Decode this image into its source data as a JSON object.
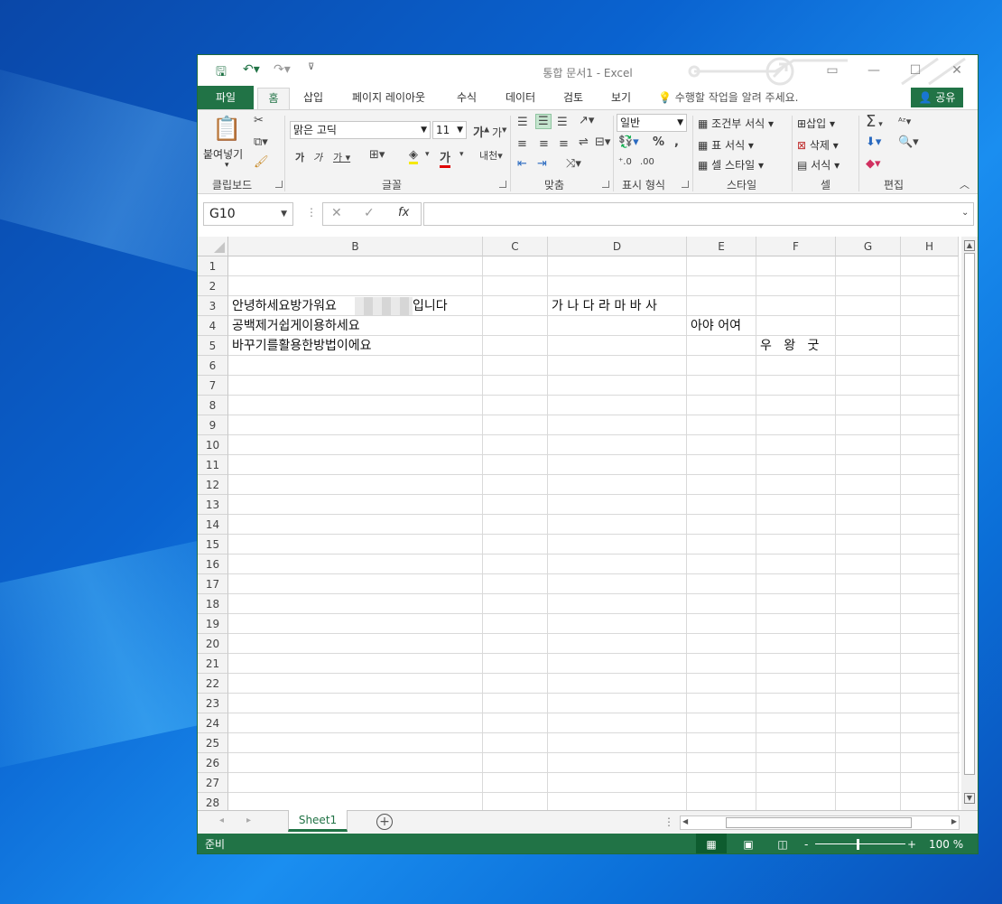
{
  "window": {
    "title": "통합 문서1 - Excel"
  },
  "menu_tabs": [
    "파일",
    "홈",
    "삽입",
    "페이지 레이아웃",
    "수식",
    "데이터",
    "검토",
    "보기"
  ],
  "tell_me": "수행할 작업을 알려 주세요.",
  "share_label": "공유",
  "ribbon": {
    "paste_label": "붙여넣기",
    "font_name": "맑은 고딕",
    "font_size": "11",
    "number_format": "일반",
    "conditional_format": "조건부 서식",
    "table_format": "표 서식",
    "cell_style": "셀 스타일",
    "insert": "삽입",
    "delete": "삭제",
    "format": "서식",
    "groups": [
      "클립보드",
      "글꼴",
      "맞춤",
      "표시 형식",
      "스타일",
      "셀",
      "편집"
    ]
  },
  "name_box": "G10",
  "columns": [
    "B",
    "C",
    "D",
    "E",
    "F",
    "G",
    "H"
  ],
  "rows": [
    "1",
    "2",
    "3",
    "4",
    "5",
    "6",
    "7",
    "8",
    "9",
    "10",
    "11",
    "12",
    "13",
    "14",
    "15",
    "16",
    "17",
    "18",
    "19",
    "20",
    "21",
    "22",
    "23",
    "24",
    "25",
    "26",
    "27",
    "28"
  ],
  "cells": {
    "B3a": "안녕하세요방가워요",
    "B3b": "입니다",
    "D3": "가 나 다 라 마 바 사",
    "B4": "공백제거쉽게이용하세요",
    "E4": "아야 어여",
    "B5": "바꾸기를활용한방법이에요",
    "F5": "우   왕   굿"
  },
  "sheet_tab": "Sheet1",
  "status": {
    "ready": "준비",
    "zoom": "100 %"
  },
  "colors": {
    "excel_green": "#217346"
  }
}
